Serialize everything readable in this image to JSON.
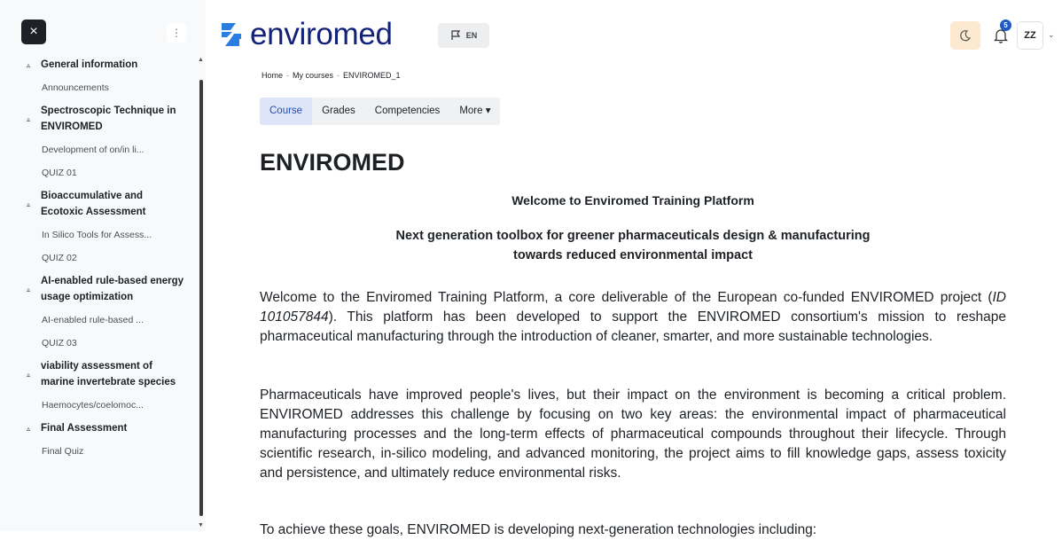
{
  "sidebar": {
    "close_glyph": "×",
    "menu_glyph": "⋮",
    "sections": [
      {
        "title": "General information",
        "items": [
          "Announcements"
        ]
      },
      {
        "title": "Spectroscopic Technique in ENVIROMED",
        "items": [
          "Development of on/in li...",
          "QUIZ 01"
        ]
      },
      {
        "title": "Bioaccumulative and Ecotoxic Assessment",
        "items": [
          "In Silico Tools for Assess...",
          "QUIZ 02"
        ]
      },
      {
        "title": "AI-enabled rule-based energy usage optimization",
        "items": [
          "AI-enabled rule-based ...",
          "QUIZ 03"
        ]
      },
      {
        "title": "viability assessment of marine invertebrate species",
        "items": [
          "Haemocytes/coelomoc..."
        ]
      },
      {
        "title": "Final Assessment",
        "items": [
          "Final Quiz"
        ]
      }
    ]
  },
  "header": {
    "logo_text": "enviromed",
    "language": "EN",
    "notification_count": "5",
    "user_initials": "ZZ"
  },
  "breadcrumb": [
    "Home",
    "My courses",
    "ENVIROMED_1"
  ],
  "tabs": [
    "Course",
    "Grades",
    "Competencies",
    "More ▾"
  ],
  "content": {
    "title": "ENVIROMED",
    "subtitle1": "Welcome to Enviromed Training Platform",
    "subtitle2_line1": "Next generation toolbox for greener pharmaceuticals design & manufacturing",
    "subtitle2_line2": "towards reduced environmental impact",
    "p1_before": "Welcome to the Enviromed Training Platform, a core deliverable of the European co-funded ENVIROMED project (",
    "p1_id": "ID 101057844",
    "p1_after": "). This platform has been developed to support the ENVIROMED consortium's mission to reshape pharmaceutical manufacturing through the introduction of cleaner, smarter, and more sustainable technologies.",
    "p2": "Pharmaceuticals have improved people's lives, but their impact on the environment is becoming a critical problem. ENVIROMED addresses this challenge by focusing on two key areas: the environmental impact of pharmaceutical manufacturing processes and the long-term effects of pharmaceutical compounds throughout their lifecycle. Through scientific research, in-silico modeling, and advanced monitoring, the project aims to fill knowledge gaps, assess toxicity and persistence, and ultimately reduce environmental risks.",
    "p3": "To achieve these goals, ENVIROMED is developing next-generation technologies including:"
  },
  "colors": {
    "brand": "#12217a",
    "accent": "#1f4fb5",
    "badge": "#1f57c3",
    "theme_button": "#fce9cf"
  }
}
